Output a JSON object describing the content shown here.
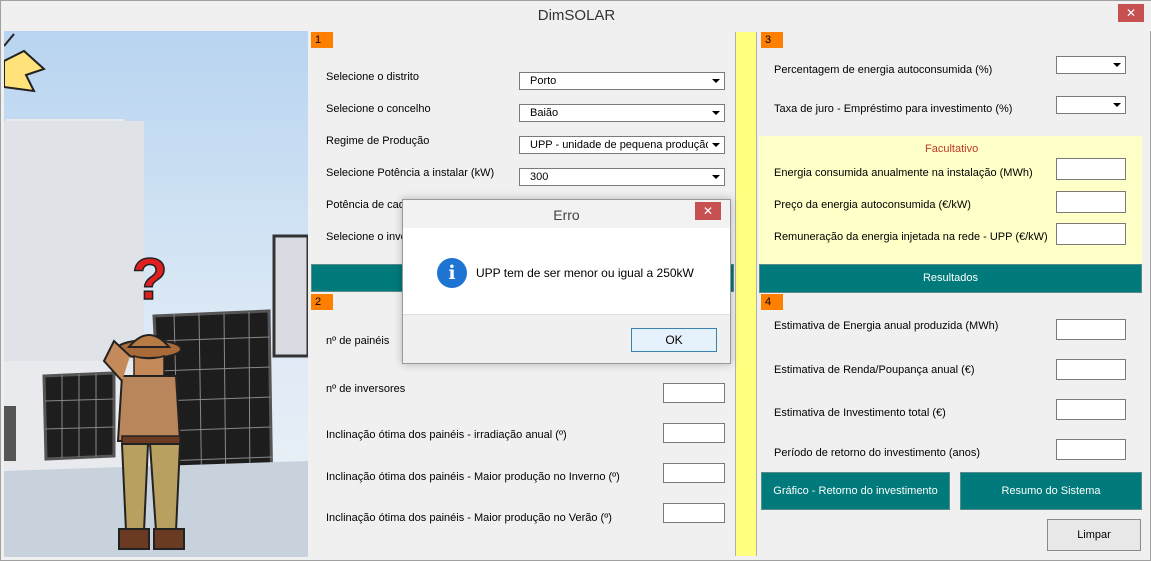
{
  "window": {
    "title": "DimSOLAR",
    "close_glyph": "✕"
  },
  "section1": {
    "tag": "1",
    "rows": [
      {
        "label": "Selecione o distrito",
        "value": "Porto"
      },
      {
        "label": "Selecione o concelho",
        "value": "Baião"
      },
      {
        "label": "Regime de Produção",
        "value": "UPP - unidade de pequena produção"
      },
      {
        "label": "Selecione Potência a instalar (kW)",
        "value": "300"
      },
      {
        "label": "Potência de cad",
        "value": ""
      },
      {
        "label": "Selecione o inve",
        "value": ""
      }
    ]
  },
  "section2": {
    "tag": "2",
    "rows": [
      {
        "label": "nº de painéis"
      },
      {
        "label": "nº de inversores"
      },
      {
        "label": "Inclinação ótima dos painéis - irradiação anual (º)"
      },
      {
        "label": "Inclinação ótima dos painéis - Maior produção no Inverno (º)"
      },
      {
        "label": "Inclinação ótima dos painéis - Maior produção no Verão (º)"
      }
    ]
  },
  "section3": {
    "tag": "3",
    "rows": [
      {
        "label": "Percentagem de energia autoconsumida (%)"
      },
      {
        "label": "Taxa de juro - Empréstimo para investimento (%)"
      }
    ],
    "optional": {
      "title": "Facultativo",
      "rows": [
        {
          "label": "Energia consumida anualmente na instalação  (MWh)"
        },
        {
          "label": "Preço da energia autoconsumida (€/kW)"
        },
        {
          "label": "Remuneração da energia injetada na rede - UPP (€/kW)"
        }
      ]
    },
    "results_button": "Resultados"
  },
  "section4": {
    "tag": "4",
    "rows": [
      {
        "label": "Estimativa de Energia anual produzida (MWh)"
      },
      {
        "label": "Estimativa de Renda/Poupança anual (€)"
      },
      {
        "label": "Estimativa de Investimento total (€)"
      },
      {
        "label": "Período de retorno do investimento (anos)"
      }
    ],
    "chart_button": "Gráfico - Retorno do investimento",
    "summary_button": "Resumo do Sistema",
    "clear_button": "Limpar"
  },
  "dialog": {
    "title": "Erro",
    "message": "UPP tem de ser menor ou igual a 250kW",
    "icon": "info-icon",
    "icon_glyph": "i",
    "ok_label": "OK",
    "close_glyph": "✕"
  },
  "colors": {
    "accent_teal": "#007a7a",
    "tag_orange": "#ff7f00",
    "optional_yellow": "#ffffc8",
    "strip_yellow": "#ffff80",
    "close_red": "#c75050",
    "info_blue": "#1e74d2"
  }
}
